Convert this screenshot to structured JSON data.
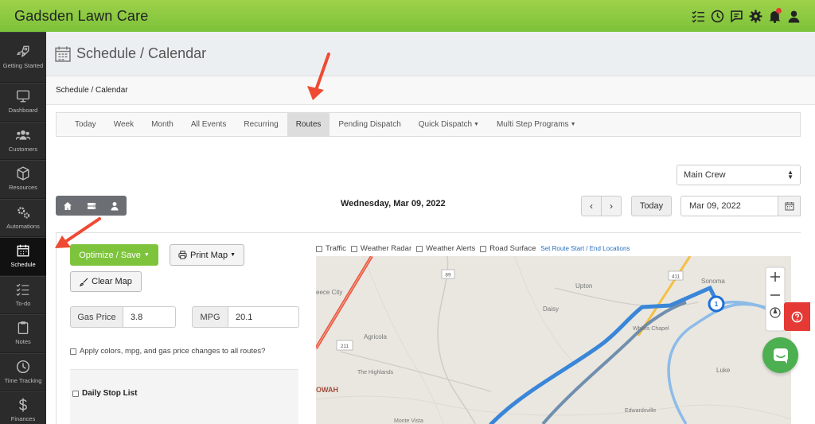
{
  "app": {
    "title": "Gadsden Lawn Care"
  },
  "topbar_icons": [
    "checklist-icon",
    "clock-icon",
    "chat-icon",
    "gear-icon",
    "bell-icon",
    "user-icon"
  ],
  "sidebar": {
    "items": [
      {
        "label": "Getting Started",
        "icon": "rocket-icon"
      },
      {
        "label": "Dashboard",
        "icon": "monitor-icon"
      },
      {
        "label": "Customers",
        "icon": "users-icon"
      },
      {
        "label": "Resources",
        "icon": "box-icon"
      },
      {
        "label": "Automations",
        "icon": "gears-icon"
      },
      {
        "label": "Schedule",
        "icon": "calendar-icon",
        "active": true
      },
      {
        "label": "To-do",
        "icon": "list-icon"
      },
      {
        "label": "Notes",
        "icon": "clipboard-icon"
      },
      {
        "label": "Time Tracking",
        "icon": "clock-icon"
      },
      {
        "label": "Finances",
        "icon": "dollar-icon"
      }
    ]
  },
  "page": {
    "title": "Schedule / Calendar",
    "breadcrumb": "Schedule / Calendar"
  },
  "tabs": [
    {
      "label": "Today"
    },
    {
      "label": "Week"
    },
    {
      "label": "Month"
    },
    {
      "label": "All Events"
    },
    {
      "label": "Recurring"
    },
    {
      "label": "Routes",
      "active": true
    },
    {
      "label": "Pending Dispatch"
    },
    {
      "label": "Quick Dispatch",
      "dropdown": true
    },
    {
      "label": "Multi Step Programs",
      "dropdown": true
    }
  ],
  "crew": {
    "selected": "Main Crew"
  },
  "date": {
    "heading": "Wednesday, Mar 09, 2022",
    "today_label": "Today",
    "value": "Mar 09, 2022"
  },
  "route": {
    "optimize_label": "Optimize / Save",
    "print_label": "Print Map",
    "clear_label": "Clear Map",
    "gas_price_label": "Gas Price",
    "gas_price": "3.8",
    "mpg_label": "MPG",
    "mpg": "20.1",
    "apply_label": "Apply colors, mpg, and gas price changes to all routes?",
    "daily_stop_label": "Daily Stop List"
  },
  "map_options": {
    "traffic": "Traffic",
    "weather_radar": "Weather Radar",
    "weather_alerts": "Weather Alerts",
    "road_surface": "Road Surface",
    "set_route_link": "Set Route Start / End Locations"
  },
  "map_labels": {
    "road_89": "89",
    "road_411": "411",
    "road_211": "211",
    "sonoma": "Sonoma",
    "upton": "Upton",
    "reece_city": "eece City",
    "daisy": "Daisy",
    "whites_chapel": "Whites Chapel",
    "agricola": "Agricola",
    "the_highlands": "The Highlands",
    "luke": "Luke",
    "owah": "OWAH",
    "edwardsville": "Edwardsville",
    "monte_vista": "Monte Vista",
    "stop_number": "1"
  },
  "colors": {
    "brand_green": "#7cc23a",
    "route_blue": "#3a86d8",
    "help_red": "#e53935"
  }
}
